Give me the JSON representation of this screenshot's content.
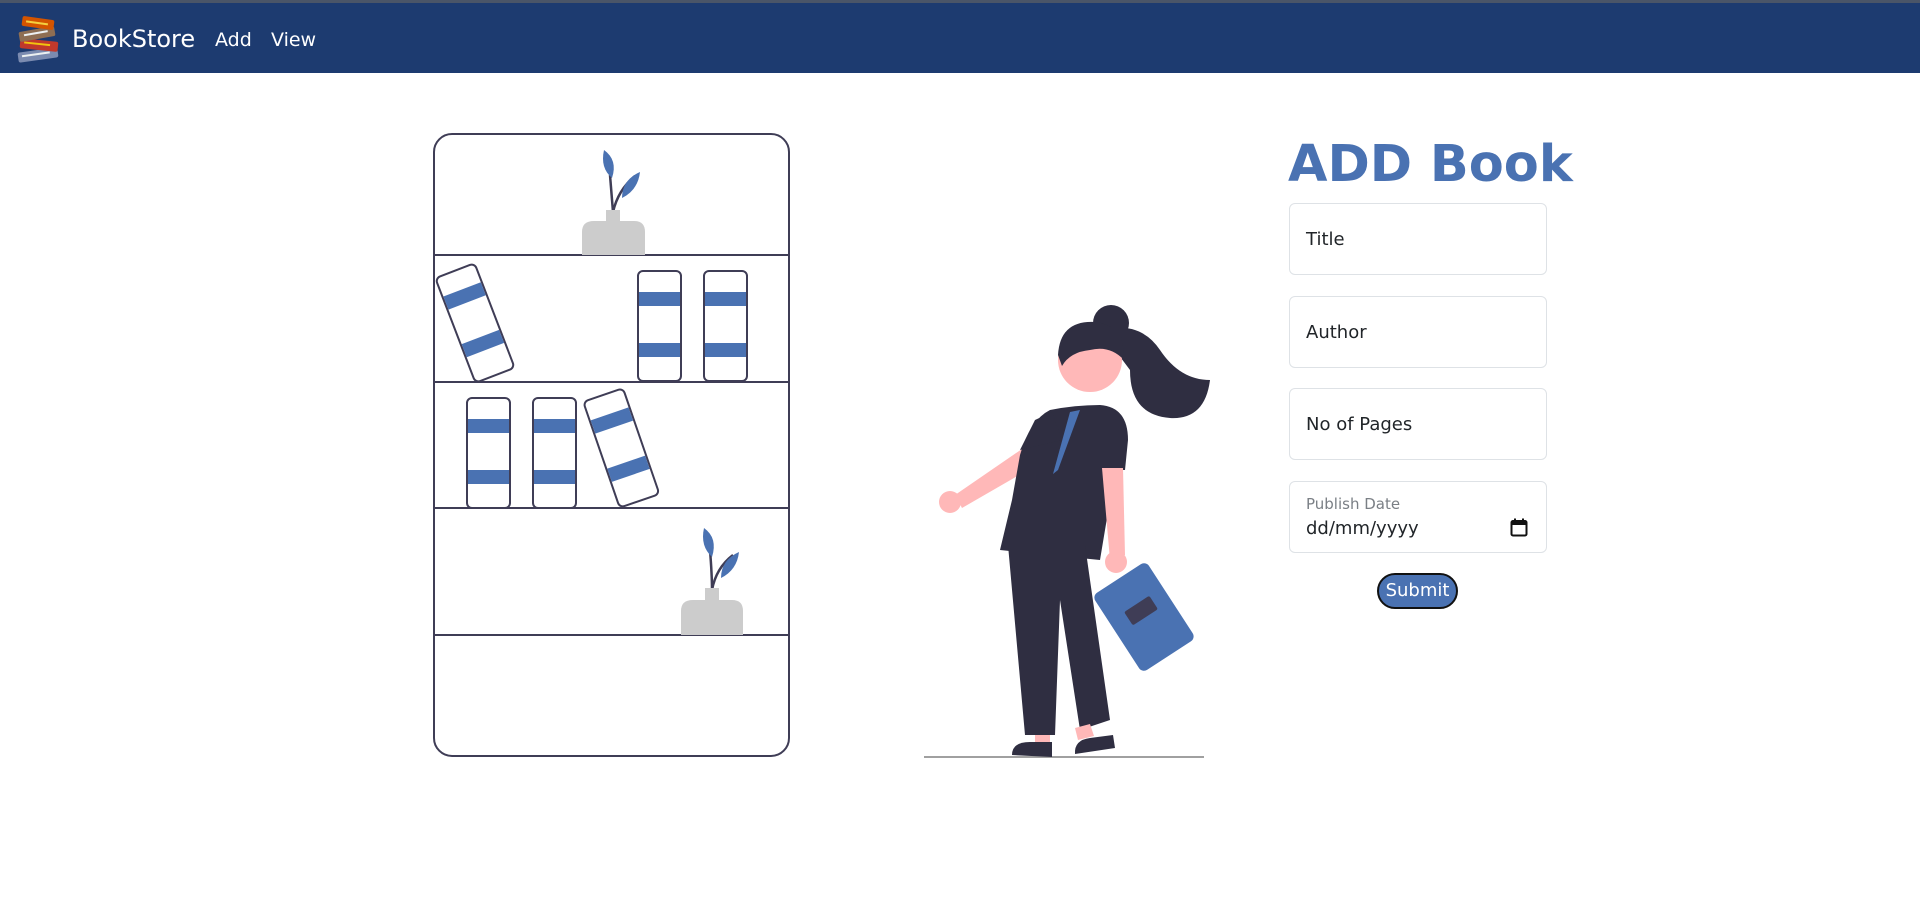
{
  "navbar": {
    "brand_name": "BookStore",
    "brand_logo_icon": "books-stack-icon",
    "links": [
      {
        "label": "Add"
      },
      {
        "label": "View"
      }
    ],
    "background_color": "#1d3b70"
  },
  "form": {
    "heading": "ADD Book",
    "fields": {
      "title": {
        "placeholder": "Title",
        "value": ""
      },
      "author": {
        "placeholder": "Author",
        "value": ""
      },
      "pages": {
        "placeholder": "No of Pages",
        "value": ""
      },
      "publish_date": {
        "label": "Publish Date",
        "value": "dd/mm/yyyy",
        "icon": "calendar-icon"
      }
    },
    "submit_label": "Submit",
    "accent_color": "#4a72b2"
  },
  "illustration": {
    "description_icons": [
      "bookshelf-illustration",
      "woman-carrying-book-illustration"
    ]
  }
}
